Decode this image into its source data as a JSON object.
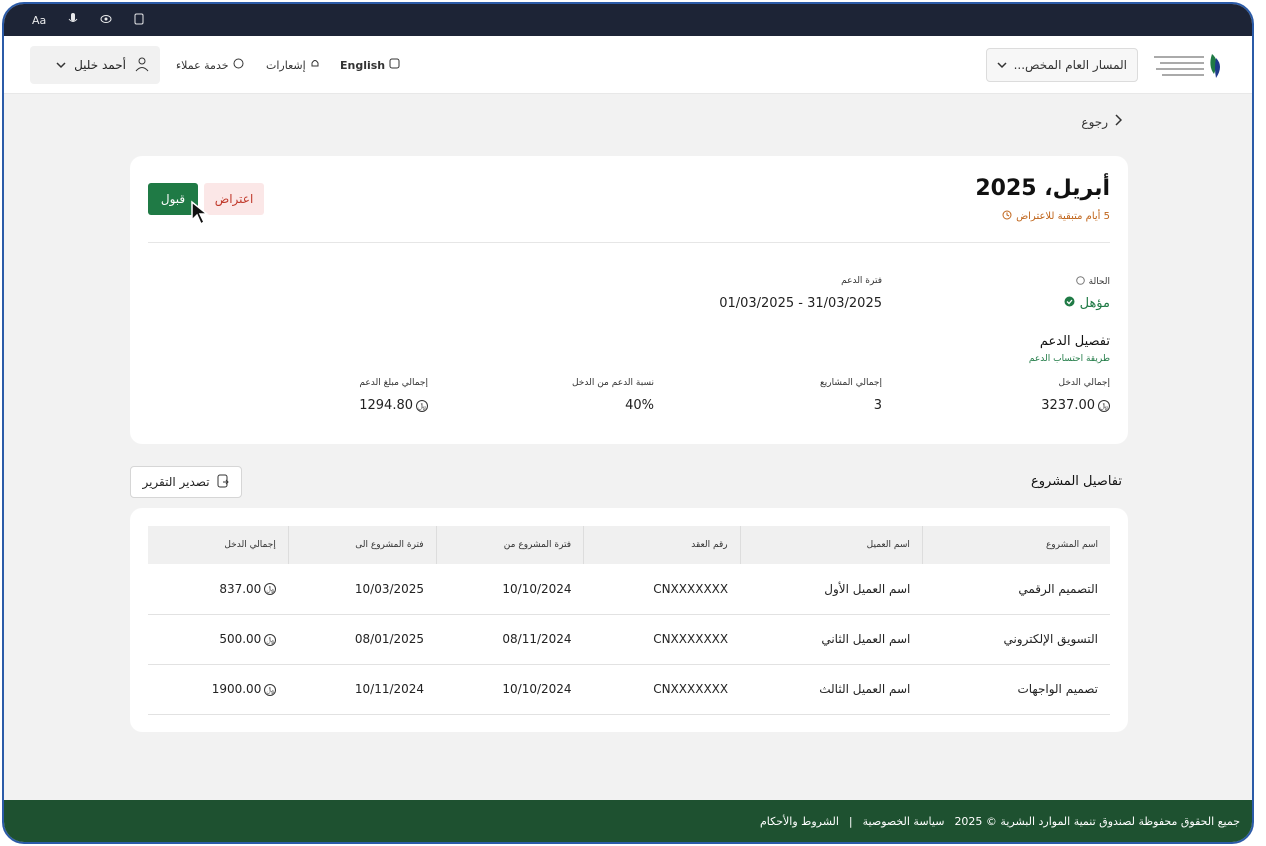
{
  "system_bar": {
    "aa": "Aa"
  },
  "header": {
    "user_name": "أحمد خليل",
    "customer_service": "خدمة عملاء",
    "notifications": "إشعارات",
    "language": "English",
    "path_select": "المسار العام المخص..."
  },
  "back_label": "رجوع",
  "summary": {
    "title": "أبريل، 2025",
    "days_left": "5 أيام متبقية للاعتراض",
    "accept_label": "قبول",
    "object_label": "اعتراض",
    "status_label": "الحالة",
    "status_value": "مؤهل",
    "period_label": "فترة الدعم",
    "period_value": "01/03/2025 - 31/03/2025",
    "details_title": "تفصيل الدعم",
    "calc_method": "طريقة احتساب الدعم",
    "total_income_label": "إجمالي الدخل",
    "total_income_value": "3237.00",
    "total_projects_label": "إجمالي المشاريع",
    "total_projects_value": "3",
    "support_ratio_label": "نسبة الدعم من الدخل",
    "support_ratio_value": "40%",
    "total_support_label": "إجمالي مبلغ الدعم",
    "total_support_value": "1294.80"
  },
  "projects": {
    "title": "تفاصيل المشروع",
    "export_label": "تصدير التقرير",
    "columns": [
      "اسم المشروع",
      "اسم العميل",
      "رقم العقد",
      "فترة المشروع من",
      "فترة المشروع الى",
      "إجمالي الدخل"
    ],
    "rows": [
      [
        "التصميم الرقمي",
        "اسم العميل الأول",
        "CNXXXXXXX",
        "10/10/2024",
        "10/03/2025",
        "837.00"
      ],
      [
        "التسويق الإلكتروني",
        "اسم العميل الثاني",
        "CNXXXXXXX",
        "08/11/2024",
        "08/01/2025",
        "500.00"
      ],
      [
        "تصميم الواجهات",
        "اسم العميل الثالث",
        "CNXXXXXXX",
        "10/10/2024",
        "10/11/2024",
        "1900.00"
      ]
    ]
  },
  "footer": {
    "copyright": "جميع الحقوق محفوظة لصندوق تنمية الموارد البشرية © 2025",
    "privacy": "سياسة الخصوصية",
    "sep": "|",
    "terms": "الشروط والأحكام"
  },
  "colors": {
    "primary_green": "#1f7a45",
    "footer_green": "#1e5130",
    "warning": "#c0651b",
    "object_red": "#c0392b"
  }
}
